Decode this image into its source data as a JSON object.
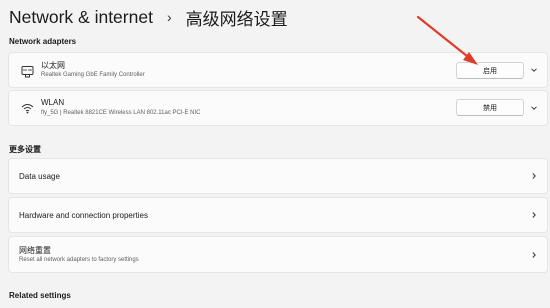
{
  "header": {
    "parent": "Network & internet",
    "separator": "›",
    "current": "高级网络设置"
  },
  "network_adapters": {
    "section_title": "Network adapters",
    "items": [
      {
        "name": "以太网",
        "description": "Realtek Gaming GbE Family Controller",
        "button_label": "启用",
        "icon": "ethernet-icon"
      },
      {
        "name": "WLAN",
        "description": "fly_5G | Realtek 8821CE Wireless LAN 802.11ac PCI-E NIC",
        "button_label": "禁用",
        "icon": "wifi-icon"
      }
    ]
  },
  "more_settings": {
    "section_title": "更多设置",
    "items": [
      {
        "title": "Data usage"
      },
      {
        "title": "Hardware and connection properties"
      },
      {
        "title": "网络重置",
        "description": "Reset all network adapters to factory settings"
      }
    ]
  },
  "related_settings": {
    "section_title": "Related settings"
  },
  "colors": {
    "annotation_arrow": "#e03c2a",
    "background": "#f3f3f3",
    "card": "#fbfbfb"
  }
}
